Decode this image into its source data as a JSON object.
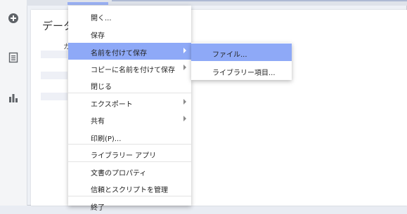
{
  "document": {
    "title": "データ",
    "subtitle": "カ"
  },
  "sidebar_icons": [
    "plus-circle-icon",
    "document-icon",
    "bar-chart-icon"
  ],
  "file_menu": {
    "items": [
      {
        "label": "開く..."
      },
      {
        "label": "保存"
      },
      {
        "label": "名前を付けて保存"
      },
      {
        "label": "コピーに名前を付けて保存"
      },
      {
        "label": "閉じる"
      },
      {
        "label": "エクスポート"
      },
      {
        "label": "共有"
      },
      {
        "label": "印刷(P)..."
      },
      {
        "label": "ライブラリー アプリ"
      },
      {
        "label": "文書のプロパティ"
      },
      {
        "label": "信頼とスクリプトを管理"
      },
      {
        "label": "終了"
      }
    ]
  },
  "save_as_submenu": {
    "items": [
      {
        "label": "ファイル..."
      },
      {
        "label": "ライブラリー項目..."
      }
    ]
  },
  "colors": {
    "highlight": "#8ea9f7",
    "menu_background": "#ffffff",
    "app_background": "#eef1f6"
  }
}
